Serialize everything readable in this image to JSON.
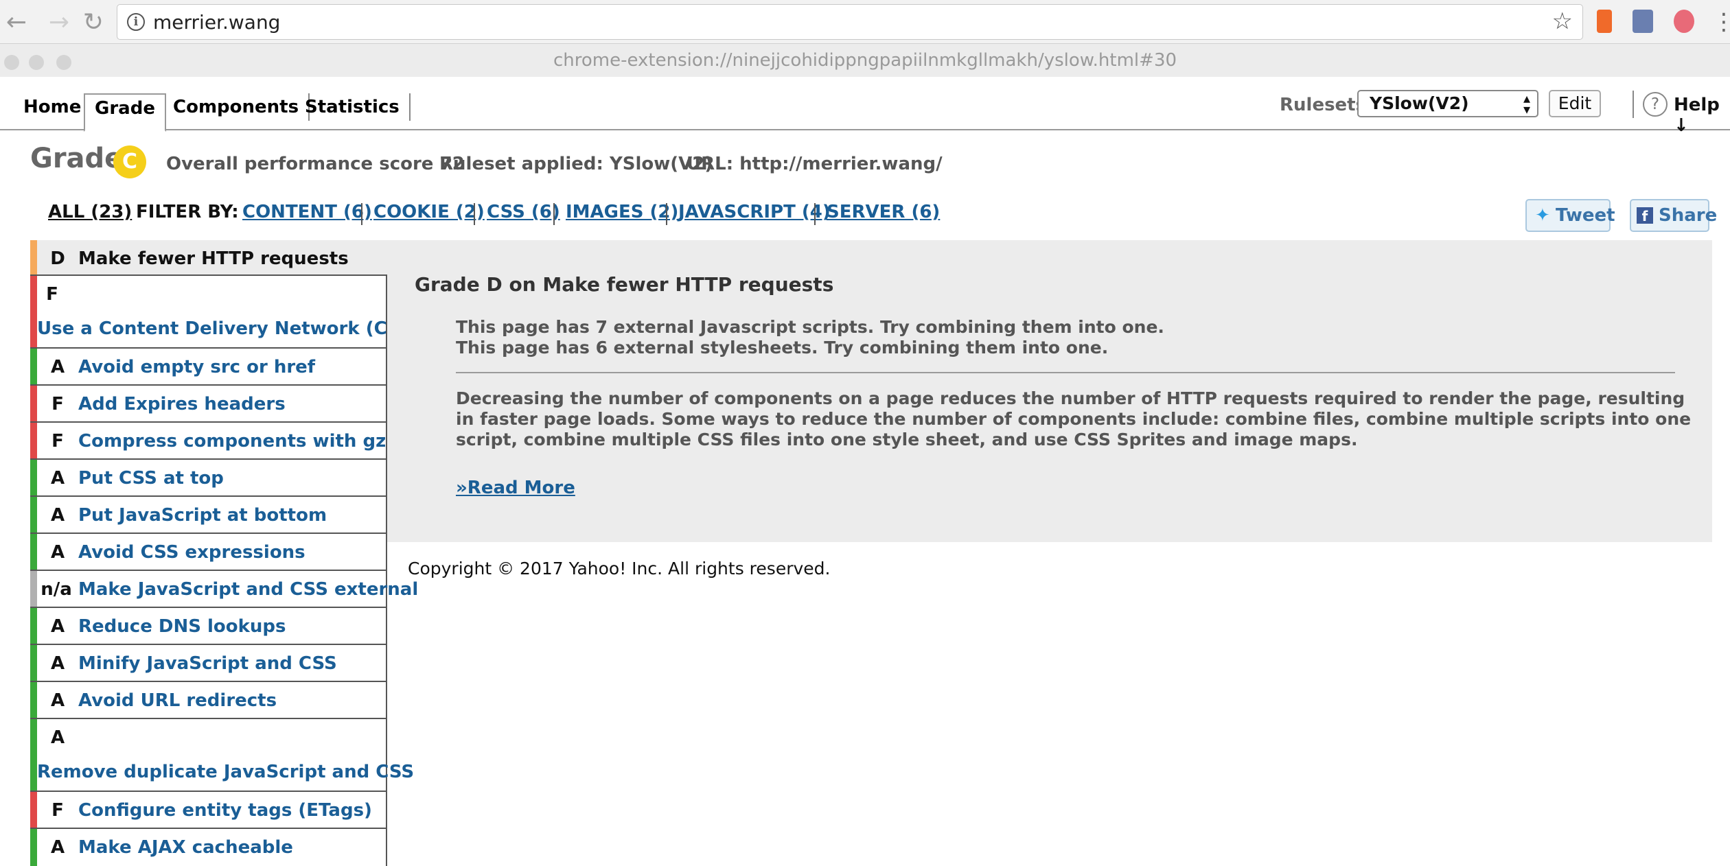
{
  "browser": {
    "url": "merrier.wang",
    "popup_title": "chrome-extension://ninejjcohidippngpapiilnmkgllmakh/yslow.html#30"
  },
  "tabs": {
    "home": "Home",
    "grade": "Grade",
    "components": "Components",
    "statistics": "Statistics"
  },
  "toolbar": {
    "rulesets_label": "Rulesets",
    "ruleset_value": "YSlow(V2)",
    "edit_label": "Edit",
    "help_label": "Help ↓"
  },
  "grade_header": {
    "label": "Grade",
    "grade": "C",
    "score_text": "Overall performance score 72",
    "ruleset_text": "Ruleset applied: YSlow(V2)",
    "url_text": "URL: http://merrier.wang/"
  },
  "filters": {
    "all": "ALL (23)",
    "filter_by": "FILTER BY:",
    "items": [
      "CONTENT (6)",
      "COOKIE (2)",
      "CSS (6)",
      "IMAGES (2)",
      "JAVASCRIPT (4)",
      "SERVER (6)"
    ]
  },
  "social": {
    "tweet": "Tweet",
    "share": "Share"
  },
  "rules": [
    {
      "grade": "D",
      "name": "Make fewer HTTP requests"
    },
    {
      "grade": "F",
      "name": "Use a Content Delivery Network (CDN)"
    },
    {
      "grade": "A",
      "name": "Avoid empty src or href"
    },
    {
      "grade": "F",
      "name": "Add Expires headers"
    },
    {
      "grade": "F",
      "name": "Compress components with gzip"
    },
    {
      "grade": "A",
      "name": "Put CSS at top"
    },
    {
      "grade": "A",
      "name": "Put JavaScript at bottom"
    },
    {
      "grade": "A",
      "name": "Avoid CSS expressions"
    },
    {
      "grade": "n/a",
      "name": "Make JavaScript and CSS external"
    },
    {
      "grade": "A",
      "name": "Reduce DNS lookups"
    },
    {
      "grade": "A",
      "name": "Minify JavaScript and CSS"
    },
    {
      "grade": "A",
      "name": "Avoid URL redirects"
    },
    {
      "grade": "A",
      "name": "Remove duplicate JavaScript and CSS"
    },
    {
      "grade": "F",
      "name": "Configure entity tags (ETags)"
    },
    {
      "grade": "A",
      "name": "Make AJAX cacheable"
    }
  ],
  "colors": {
    "grade_A": "#3aa93a",
    "grade_D": "#f5a95c",
    "grade_F": "#e04848",
    "grade_na": "#b0b0b0",
    "grade_badge": "#f5cf1a",
    "link": "#1a5e96"
  },
  "detail": {
    "heading": "Grade D on Make fewer HTTP requests",
    "lines": [
      "This page has 7 external Javascript scripts. Try combining them into one.",
      "This page has 6 external stylesheets. Try combining them into one."
    ],
    "paragraph": "Decreasing the number of components on a page reduces the number of HTTP requests required to render the page, resulting in faster page loads. Some ways to reduce the number of components include: combine files, combine multiple scripts into one script, combine multiple CSS files into one style sheet, and use CSS Sprites and image maps.",
    "read_more": "»Read More"
  },
  "footer": {
    "copyright": "Copyright © 2017 Yahoo! Inc. All rights reserved."
  }
}
